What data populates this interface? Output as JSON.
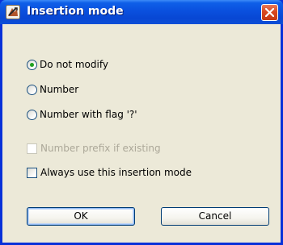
{
  "dialog": {
    "title": "Insertion mode",
    "close_icon": "close-icon",
    "app_icon": "insertion-app-icon"
  },
  "options": [
    {
      "label": "Do not modify",
      "selected": true
    },
    {
      "label": "Number",
      "selected": false
    },
    {
      "label": "Number with flag '?'",
      "selected": false
    }
  ],
  "checkboxes": [
    {
      "label": "Number prefix if existing",
      "checked": false,
      "enabled": false
    },
    {
      "label": "Always use this insertion mode",
      "checked": false,
      "enabled": true
    }
  ],
  "buttons": {
    "ok_label": "OK",
    "cancel_label": "Cancel"
  },
  "colors": {
    "titlebar": "#0a50de",
    "client": "#ece9d8",
    "close_button": "#d9481f",
    "radio_dot": "#21a121"
  }
}
